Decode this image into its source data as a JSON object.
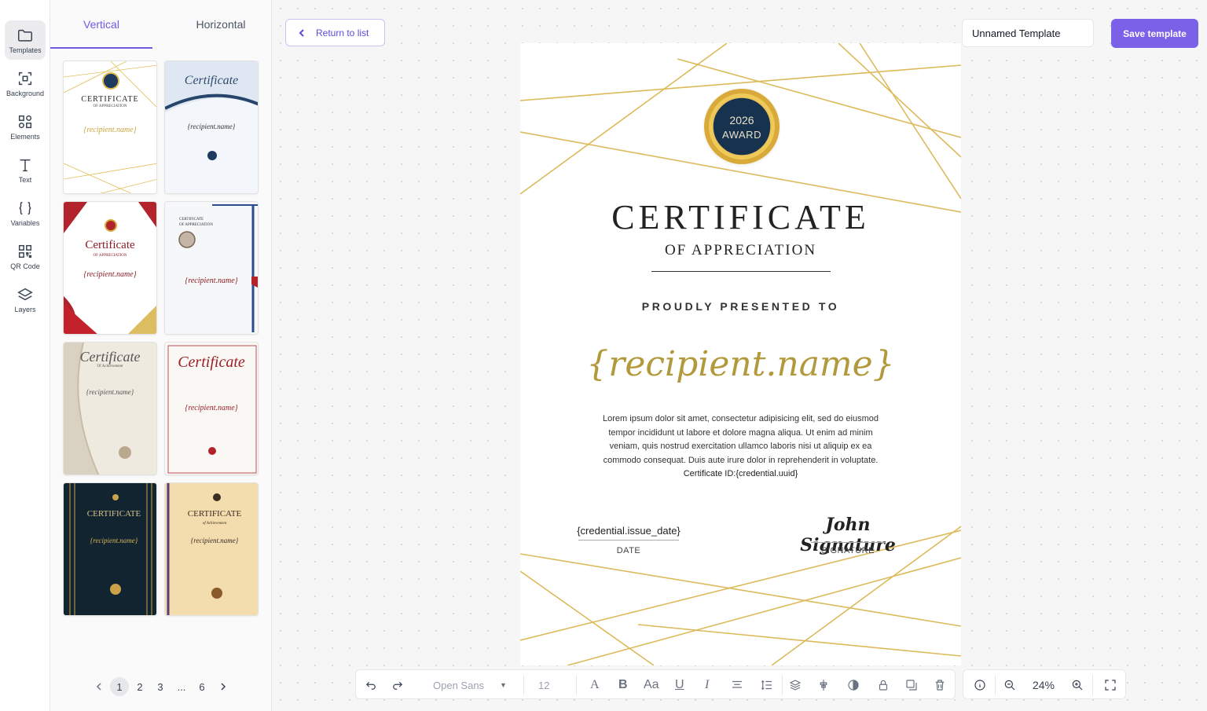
{
  "rail": {
    "items": [
      {
        "label": "Templates",
        "icon": "folder-icon",
        "active": true
      },
      {
        "label": "Background",
        "icon": "background-icon"
      },
      {
        "label": "Elements",
        "icon": "elements-icon"
      },
      {
        "label": "Text",
        "icon": "text-icon"
      },
      {
        "label": "Variables",
        "icon": "braces-icon"
      },
      {
        "label": "QR Code",
        "icon": "qr-code-icon"
      },
      {
        "label": "Layers",
        "icon": "layers-icon"
      }
    ]
  },
  "panel": {
    "tabs": [
      {
        "label": "Vertical",
        "active": true
      },
      {
        "label": "Horizontal"
      }
    ],
    "thumbnails": [
      {
        "title": "CERTIFICATE",
        "subtitle": "OF APPRECIATION",
        "name": "{recipient.name}"
      },
      {
        "title": "Certificate",
        "subtitle": "",
        "name": "{recipient.name}"
      },
      {
        "title": "Certificate",
        "subtitle": "OF APPRECIATION",
        "name": "{recipient.name}"
      },
      {
        "title": "CERTIFICATE",
        "subtitle": "OF APPRECIATION",
        "name": "{recipient.name}"
      },
      {
        "title": "Certificate",
        "subtitle": "Of Achievement",
        "name": "{recipient.name}"
      },
      {
        "title": "Certificate",
        "subtitle": "",
        "name": "{recipient.name}"
      },
      {
        "title": "CERTIFICATE",
        "subtitle": "",
        "name": "{recipient.name}"
      },
      {
        "title": "CERTIFICATE",
        "subtitle": "of Achievement",
        "name": "{recipient.name}"
      }
    ],
    "pager": {
      "pages": [
        "1",
        "2",
        "3",
        "...",
        "6"
      ],
      "current": "1"
    }
  },
  "header": {
    "return_label": "Return to list",
    "template_name": "Unnamed Template",
    "save_label": "Save template"
  },
  "certificate": {
    "badge_year": "2026",
    "badge_text": "AWARD",
    "title": "CERTIFICATE",
    "subtitle": "OF APPRECIATION",
    "presented": "PROUDLY PRESENTED TO",
    "recipient": "{recipient.name}",
    "body": "Lorem ipsum dolor sit amet, consectetur adipisicing elit, sed do eiusmod tempor incididunt ut labore et dolore magna aliqua. Ut enim ad minim veniam, quis nostrud exercitation ullamco laboris nisi ut aliquip ex ea commodo consequat. Duis aute irure dolor in reprehenderit in voluptate.",
    "credential_id": "Certificate ID:{credential.uuid}",
    "date_value": "{credential.issue_date}",
    "date_label": "DATE",
    "signature": "John Signature",
    "signature_label": "SIGNATURE",
    "accent_color": "#d4ac3a"
  },
  "toolbar": {
    "font": "Open Sans",
    "size": "12"
  },
  "zoom": {
    "value": "24%"
  },
  "colors": {
    "brand": "#7b61e8",
    "gold": "#d4ac3a"
  }
}
